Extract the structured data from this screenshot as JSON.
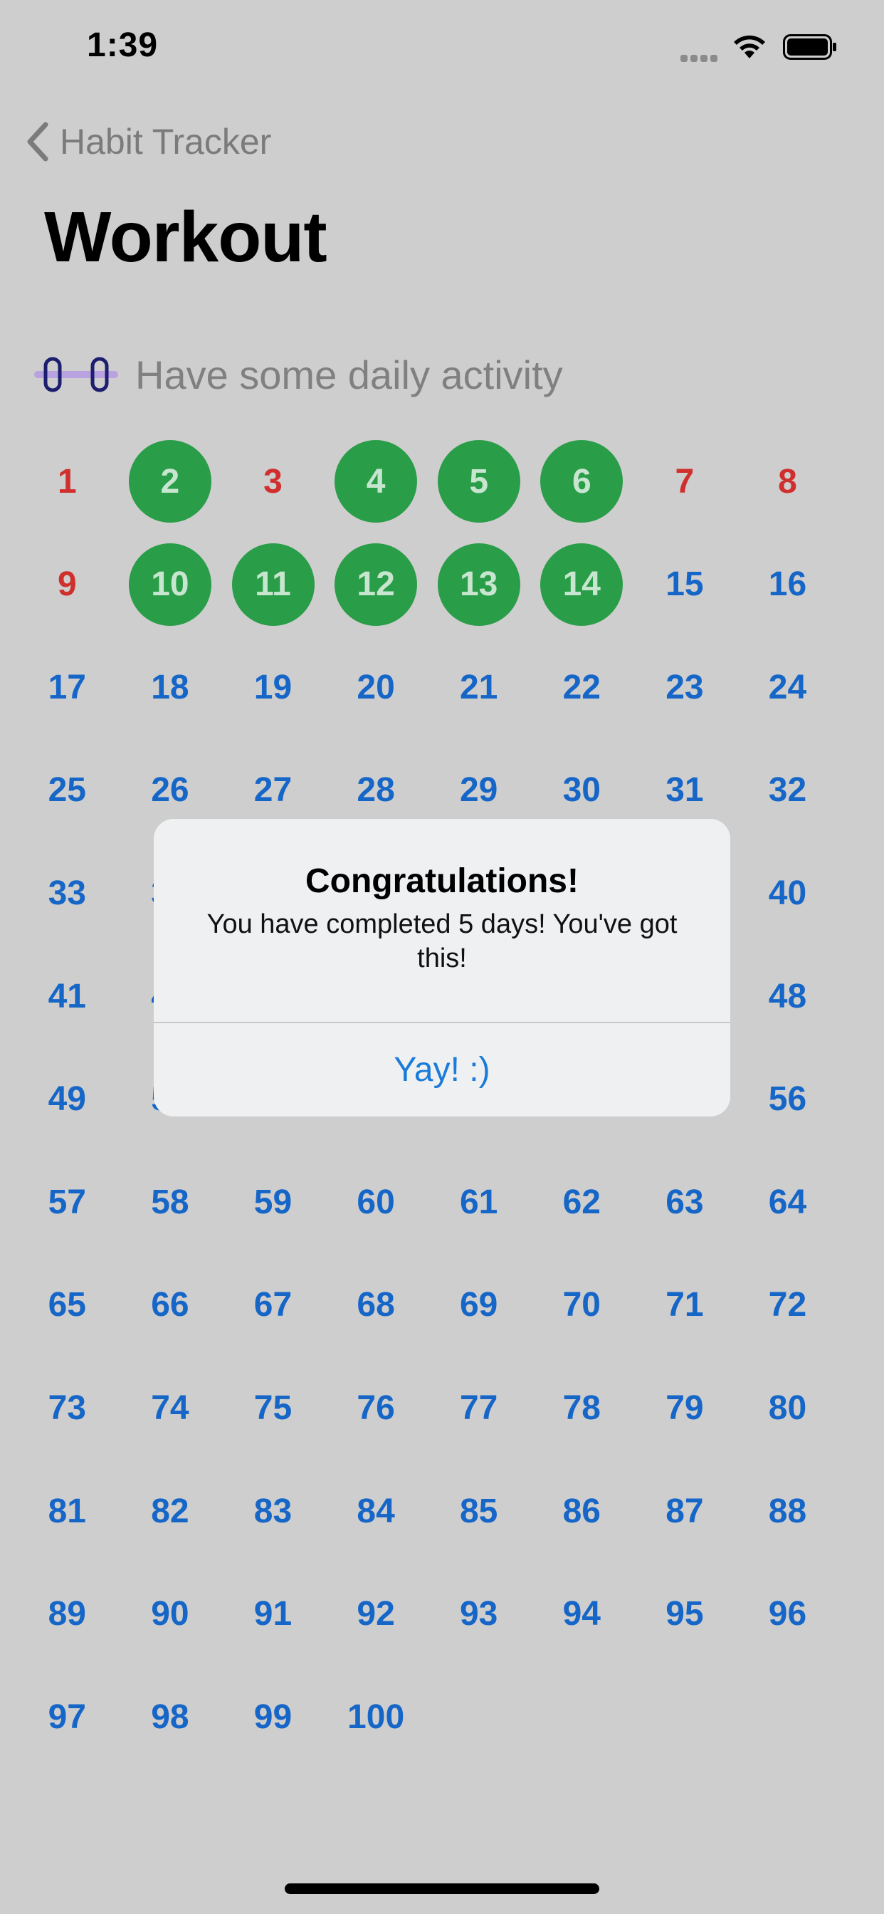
{
  "status_bar": {
    "time": "1:39"
  },
  "nav": {
    "back_label": "Habit Tracker",
    "title": "Workout"
  },
  "habit": {
    "icon": "dumbbell-icon",
    "description": "Have some daily activity"
  },
  "calendar": {
    "total_days": 100,
    "completed_days": [
      2,
      4,
      5,
      6,
      10,
      11,
      12,
      13,
      14
    ],
    "missed_days": [
      1,
      3,
      7,
      8,
      9
    ]
  },
  "dialog": {
    "title": "Congratulations!",
    "message": "You have completed 5 days! You've got this!",
    "button_label": "Yay! :)"
  },
  "colors": {
    "completed": "#2a9d48",
    "missed": "#d0302d",
    "upcoming": "#1666c8",
    "accent": "#1a7bd8"
  }
}
